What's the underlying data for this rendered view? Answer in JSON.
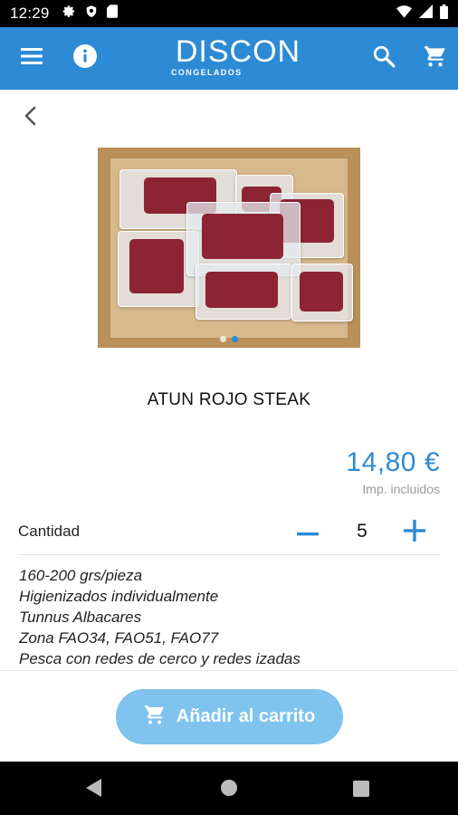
{
  "status_bar": {
    "time": "12:29"
  },
  "app_bar": {
    "logo_main": "DISCON",
    "logo_sub": "CONGELADOS"
  },
  "product": {
    "title": "ATUN ROJO STEAK",
    "price": "14,80 €",
    "tax_note": "Imp. incluidos",
    "image_pages": 2,
    "image_active_index": 1
  },
  "quantity": {
    "label": "Cantidad",
    "value": "5"
  },
  "description": [
    "160-200 grs/pieza",
    "Higienizados individualmente",
    "Tunnus Albacares",
    "Zona FAO34, FAO51, FAO77",
    "Pesca con redes de cerco y redes izadas"
  ],
  "footer": {
    "add_to_cart_label": "Añadir al carrito"
  },
  "colors": {
    "brand_blue": "#2d8ad4",
    "button_light_blue": "#7fc3ee"
  },
  "icons": [
    "settings-icon",
    "shield-icon",
    "sd-card-icon",
    "wifi-icon",
    "signal-icon",
    "battery-icon",
    "menu-icon",
    "info-icon",
    "search-icon",
    "cart-icon",
    "back-arrow-icon",
    "minus-icon",
    "plus-icon",
    "cart-button-icon",
    "nav-back-icon",
    "nav-home-icon",
    "nav-recents-icon"
  ]
}
